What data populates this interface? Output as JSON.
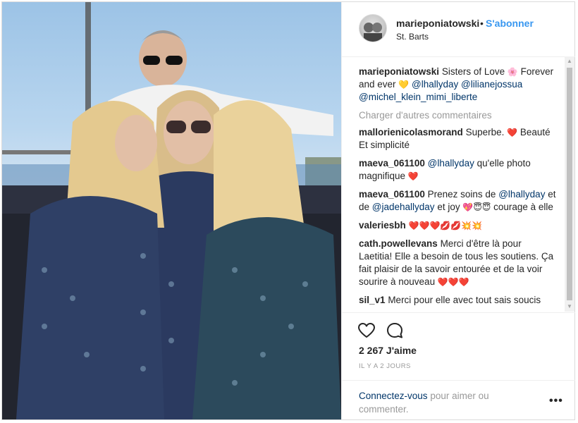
{
  "post": {
    "username": "marieponiatowski",
    "dot": "•",
    "follow_label": "S'abonner",
    "location": "St. Barts"
  },
  "caption": {
    "user": "marieponiatowski",
    "text1": "Sisters of Love",
    "emoji1": "🌸",
    "text2": "Forever and ever",
    "emoji2": "💛",
    "mentions": [
      "@lhallyday",
      "@lilianejossua",
      "@michel_klein_mimi_liberte"
    ]
  },
  "load_more_label": "Charger d'autres commentaires",
  "comments": [
    {
      "user": "mallorienicolasmorand",
      "pre": "Superbe.",
      "emoji": "❤️",
      "post": "Beauté Et simplicité"
    },
    {
      "user": "maeva_061100",
      "mention": "@lhallyday",
      "post": "qu'elle photo magnifique",
      "emoji": "❤️"
    },
    {
      "user": "maeva_061100",
      "pre": "Prenez soins de",
      "mention1": "@lhallyday",
      "mid": "et de",
      "mention2": "@jadehallyday",
      "post": "et joy",
      "emoji": "💖😇😇",
      "end": "courage à elle"
    },
    {
      "user": "valeriesbh",
      "emoji": "❤️❤️❤️💋💋💥💥"
    },
    {
      "user": "cath.powellevans",
      "pre": "Merci d'être là pour Laetitia! Elle a besoin de tous les soutiens. Ça fait plaisir de la savoir entourée et de la voir sourire à nouveau",
      "emoji": "❤️❤️❤️"
    },
    {
      "user": "sil_v1",
      "pre": "Merci pour elle avec tout sais soucis"
    }
  ],
  "icons": {
    "like": "heart-outline-icon",
    "comment": "comment-bubble-icon",
    "more": "more-dots-icon"
  },
  "likes_label": "2 267 J'aime",
  "time_label": "IL Y A 2 JOURS",
  "footer": {
    "login_link": "Connectez-vous",
    "login_text": "pour aimer ou commenter.",
    "more_label": "•••"
  },
  "colors": {
    "link": "#3897f0",
    "mention": "#003569",
    "muted": "#999999",
    "heart": "#e8132b"
  }
}
